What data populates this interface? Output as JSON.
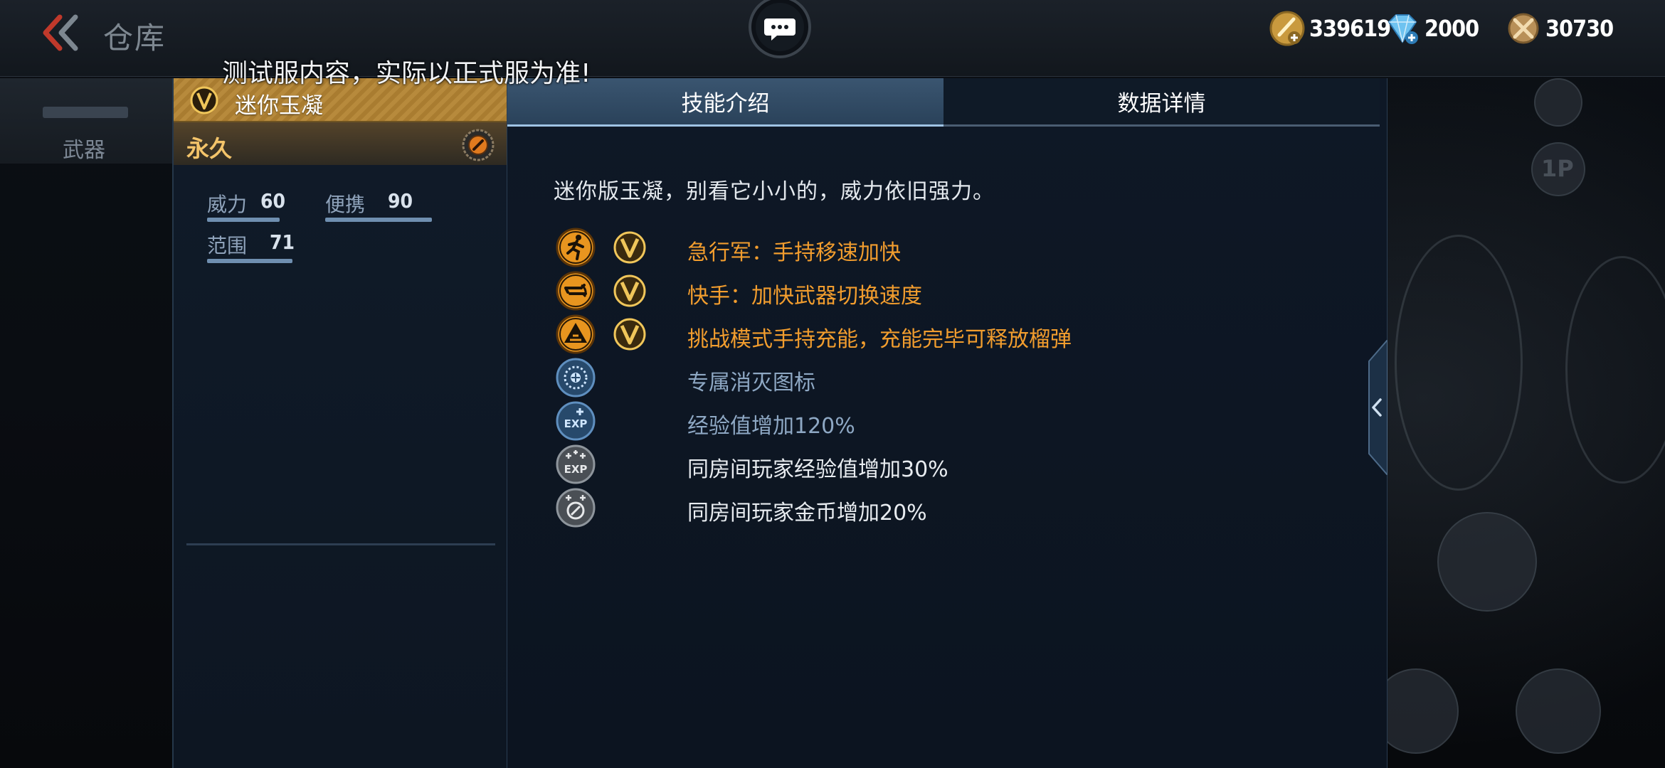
{
  "topbar": {
    "title": "仓库",
    "currencies": [
      {
        "icon": "gold-coin-icon",
        "value": "339619"
      },
      {
        "icon": "diamond-icon",
        "value": "2000"
      },
      {
        "icon": "honor-medal-icon",
        "value": "30730"
      }
    ]
  },
  "notice": "测试服内容，实际以正式服为准!",
  "background": {
    "weapon_tab": "武器",
    "right_btn_1p": "1P"
  },
  "item": {
    "name": "迷你玉凝",
    "duration": "永久",
    "stats": [
      {
        "label": "威力",
        "value": "60"
      },
      {
        "label": "便携",
        "value": "90"
      },
      {
        "label": "范围",
        "value": "71"
      }
    ]
  },
  "tabs": [
    {
      "label": "技能介绍",
      "active": true
    },
    {
      "label": "数据详情",
      "active": false
    }
  ],
  "description": "迷你版玉凝，别看它小小的，威力依旧强力。",
  "skills": [
    {
      "icon": "running-man-icon",
      "badge": "v-badge-icon",
      "text": "急行军：手持移速加快",
      "color": "gold"
    },
    {
      "icon": "weapon-swap-icon",
      "badge": "v-badge-icon",
      "text": "快手：加快武器切换速度",
      "color": "gold"
    },
    {
      "icon": "warning-triangle-icon",
      "badge": "v-badge-icon",
      "text": "挑战模式手持充能，充能完毕可释放榴弹",
      "color": "gold"
    },
    {
      "icon": "kill-mark-icon",
      "badge": "",
      "text": "专属消灭图标",
      "color": "blue"
    },
    {
      "icon": "exp-plus-icon",
      "badge": "",
      "text": "经验值增加120%",
      "color": "blue"
    },
    {
      "icon": "room-exp-icon",
      "badge": "",
      "text": "同房间玩家经验值增加30%",
      "color": "white"
    },
    {
      "icon": "room-gold-icon",
      "badge": "",
      "text": "同房间玩家金币增加20%",
      "color": "white"
    }
  ]
}
